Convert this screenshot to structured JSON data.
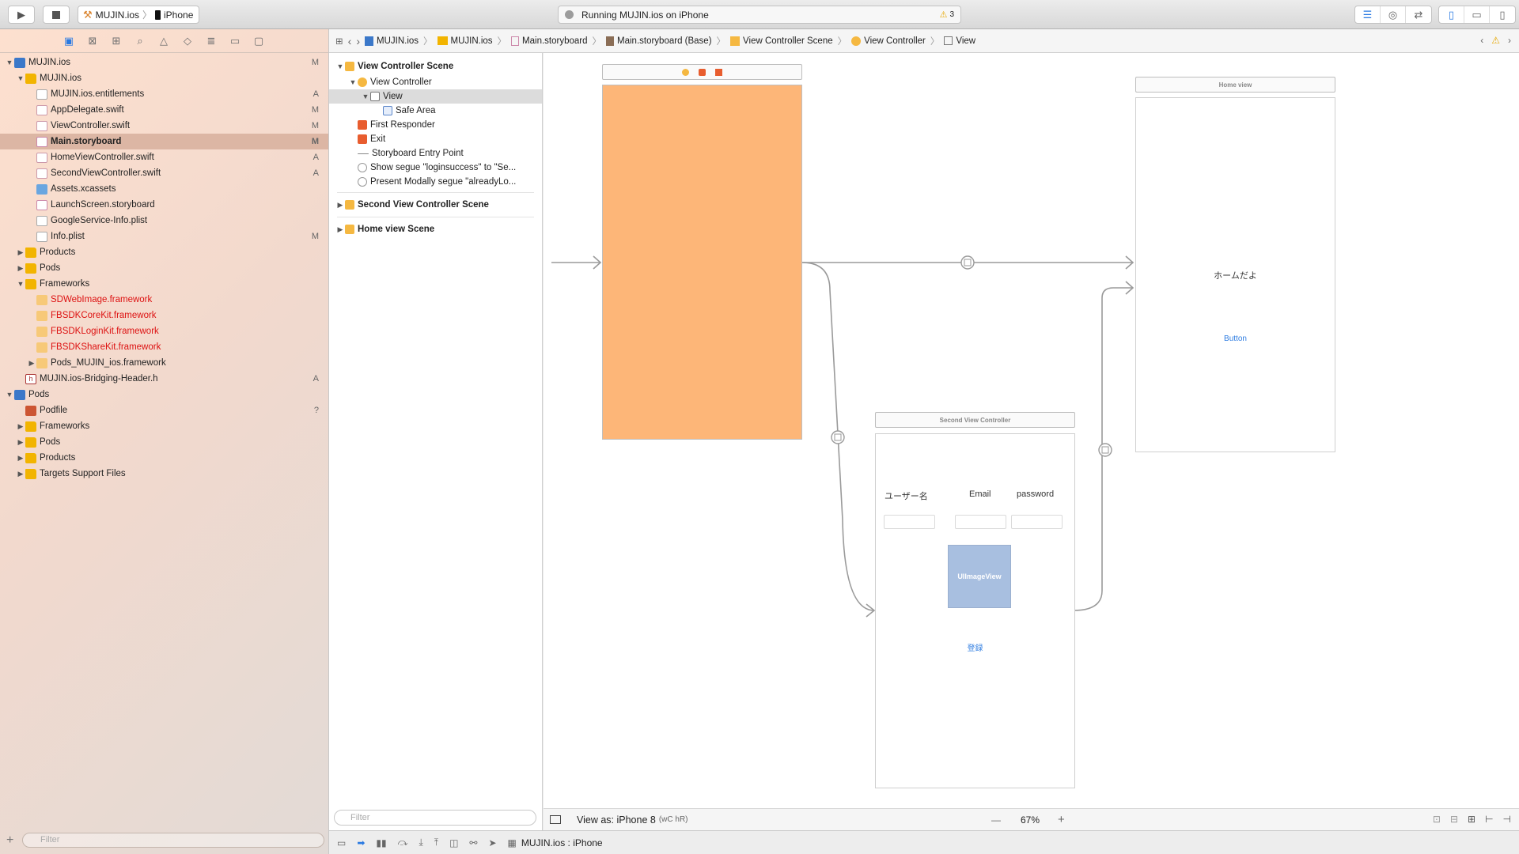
{
  "toolbar": {
    "scheme_project": "MUJIN.ios",
    "scheme_device": "iPhone",
    "activity_text": "Running MUJIN.ios on iPhone",
    "warning_count": "3",
    "play_icon": "play-icon",
    "stop_icon": "stop-icon"
  },
  "navigator": {
    "filter_placeholder": "Filter",
    "items": [
      {
        "label": "MUJIN.ios",
        "status": "M",
        "indent": 0,
        "expanded": true,
        "icon": "project"
      },
      {
        "label": "MUJIN.ios",
        "status": "",
        "indent": 1,
        "expanded": true,
        "icon": "folder"
      },
      {
        "label": "MUJIN.ios.entitlements",
        "status": "A",
        "indent": 2,
        "icon": "file"
      },
      {
        "label": "AppDelegate.swift",
        "status": "M",
        "indent": 2,
        "icon": "swift"
      },
      {
        "label": "ViewController.swift",
        "status": "M",
        "indent": 2,
        "icon": "swift"
      },
      {
        "label": "Main.storyboard",
        "status": "M",
        "indent": 2,
        "icon": "storyboard",
        "selected": true
      },
      {
        "label": "HomeViewController.swift",
        "status": "A",
        "indent": 2,
        "icon": "swift"
      },
      {
        "label": "SecondViewController.swift",
        "status": "A",
        "indent": 2,
        "icon": "swift"
      },
      {
        "label": "Assets.xcassets",
        "status": "",
        "indent": 2,
        "icon": "assets"
      },
      {
        "label": "LaunchScreen.storyboard",
        "status": "",
        "indent": 2,
        "icon": "storyboard"
      },
      {
        "label": "GoogleService-Info.plist",
        "status": "",
        "indent": 2,
        "icon": "file"
      },
      {
        "label": "Info.plist",
        "status": "M",
        "indent": 2,
        "icon": "file"
      },
      {
        "label": "Products",
        "status": "",
        "indent": 1,
        "expanded": false,
        "icon": "folder"
      },
      {
        "label": "Pods",
        "status": "",
        "indent": 1,
        "expanded": false,
        "icon": "folder"
      },
      {
        "label": "Frameworks",
        "status": "",
        "indent": 1,
        "expanded": true,
        "icon": "folder"
      },
      {
        "label": "SDWebImage.framework",
        "status": "",
        "indent": 2,
        "icon": "framework",
        "red": true
      },
      {
        "label": "FBSDKCoreKit.framework",
        "status": "",
        "indent": 2,
        "icon": "framework",
        "red": true
      },
      {
        "label": "FBSDKLoginKit.framework",
        "status": "",
        "indent": 2,
        "icon": "framework",
        "red": true
      },
      {
        "label": "FBSDKShareKit.framework",
        "status": "",
        "indent": 2,
        "icon": "framework",
        "red": true
      },
      {
        "label": "Pods_MUJIN_ios.framework",
        "status": "",
        "indent": 2,
        "expanded": false,
        "icon": "framework"
      },
      {
        "label": "MUJIN.ios-Bridging-Header.h",
        "status": "A",
        "indent": 1,
        "icon": "header"
      },
      {
        "label": "Pods",
        "status": "",
        "indent": 0,
        "expanded": true,
        "icon": "project"
      },
      {
        "label": "Podfile",
        "status": "?",
        "indent": 1,
        "icon": "pods"
      },
      {
        "label": "Frameworks",
        "status": "",
        "indent": 1,
        "expanded": false,
        "icon": "folder"
      },
      {
        "label": "Pods",
        "status": "",
        "indent": 1,
        "expanded": false,
        "icon": "folder"
      },
      {
        "label": "Products",
        "status": "",
        "indent": 1,
        "expanded": false,
        "icon": "folder"
      },
      {
        "label": "Targets Support Files",
        "status": "",
        "indent": 1,
        "expanded": false,
        "icon": "folder"
      }
    ]
  },
  "jumpbar": {
    "crumbs": [
      "MUJIN.ios",
      "MUJIN.ios",
      "Main.storyboard",
      "Main.storyboard (Base)",
      "View Controller Scene",
      "View Controller",
      "View"
    ]
  },
  "outline": {
    "filter_placeholder": "Filter",
    "scene1": "View Controller Scene",
    "vc": "View Controller",
    "view": "View",
    "safe_area": "Safe Area",
    "first_responder": "First Responder",
    "exit": "Exit",
    "entry_point": "Storyboard Entry Point",
    "segue1": "Show segue \"loginsuccess\" to \"Se...",
    "segue2": "Present Modally segue \"alreadyLo...",
    "scene2": "Second View Controller Scene",
    "scene3": "Home view Scene"
  },
  "canvas": {
    "home_title": "Home view",
    "home_label": "ホームだよ",
    "home_button": "Button",
    "second_title": "Second View Controller",
    "label_username": "ユーザー名",
    "label_email": "Email",
    "label_password": "password",
    "imageview_label": "UIImageView",
    "register_button": "登録",
    "vc_background": "#fdb678",
    "imageview_color": "#a8bfe0",
    "link_color": "#2f7de1"
  },
  "canvas_bar": {
    "view_as": "View as: iPhone 8",
    "size_class": "(wC hR)",
    "zoom": "67%",
    "zoom_out": "—",
    "zoom_in": "+"
  },
  "debugbar": {
    "target": "MUJIN.ios : iPhone"
  }
}
